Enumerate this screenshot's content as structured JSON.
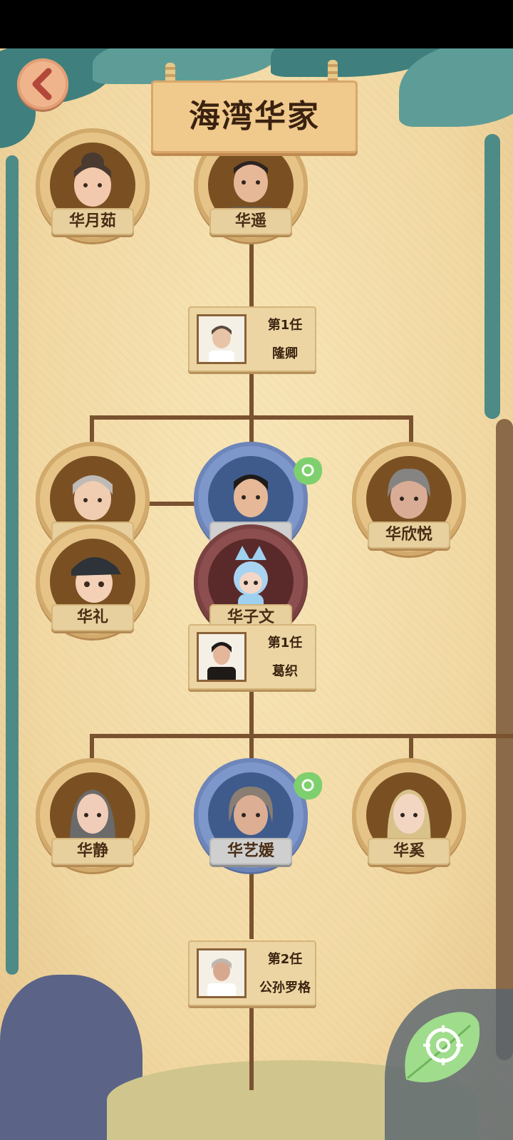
{
  "title": "海湾华家",
  "colors": {
    "paper": "#f2d9a4",
    "wood_line": "#7a5230",
    "frame_gold": "#e6c488",
    "frame_blue": "#7e97cb",
    "frame_wine": "#8c4e4e",
    "vine_teal": "#4e8a86"
  },
  "icons": {
    "back": "back-arrow-icon",
    "locate": "leaf-target-icon",
    "badge": "leaf-badge-icon"
  },
  "generation1": {
    "left": {
      "name": "华月茹"
    },
    "right": {
      "name": "华遥"
    },
    "spouse": {
      "label": "第1任",
      "name": "隆卿"
    }
  },
  "generation2": {
    "left_top": {
      "name": ""
    },
    "left_bottom": {
      "name": "华礼"
    },
    "center": {
      "name": ""
    },
    "center_child": {
      "name": "华子文"
    },
    "right": {
      "name": "华欣悦"
    },
    "spouse": {
      "label": "第1任",
      "name": "葛织"
    }
  },
  "generation3": {
    "left": {
      "name": "华静"
    },
    "center": {
      "name": "华艺媛"
    },
    "right": {
      "name": "华奚"
    },
    "spouse": {
      "label": "第2任",
      "name": "公孙罗格"
    }
  }
}
